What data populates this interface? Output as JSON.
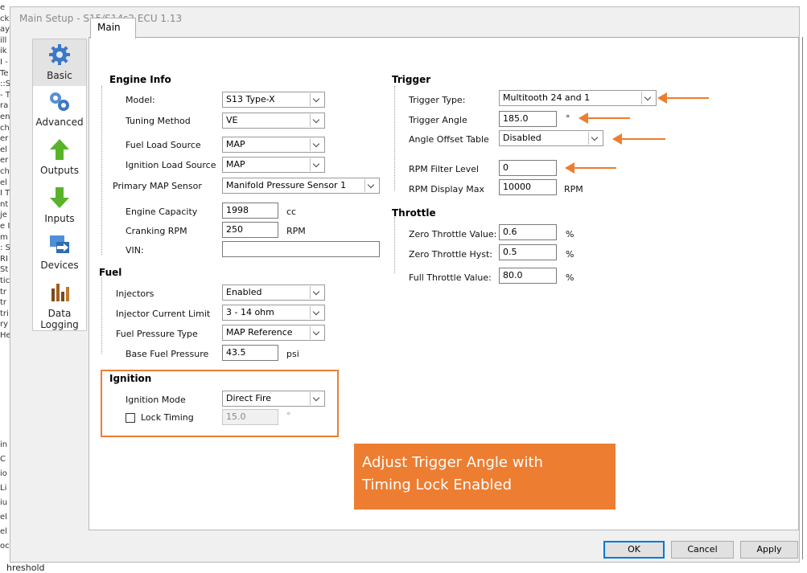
{
  "window": {
    "title": "Main Setup - S15/S14s2 ECU 1.13"
  },
  "tabs": [
    {
      "label": "Main"
    }
  ],
  "sidebar": {
    "items": [
      {
        "label": "Basic",
        "icon": "gear-icon"
      },
      {
        "label": "Advanced",
        "icon": "gears-icon"
      },
      {
        "label": "Outputs",
        "icon": "arrow-up-icon"
      },
      {
        "label": "Inputs",
        "icon": "arrow-down-icon"
      },
      {
        "label": "Devices",
        "icon": "devices-icon"
      },
      {
        "label": "Data Logging",
        "icon": "chart-icon"
      }
    ]
  },
  "engine_info": {
    "title": "Engine Info",
    "model": {
      "label": "Model:",
      "value": "S13 Type-X"
    },
    "tuning_method": {
      "label": "Tuning Method",
      "value": "VE"
    },
    "fuel_load_source": {
      "label": "Fuel Load Source",
      "value": "MAP"
    },
    "ignition_load_source": {
      "label": "Ignition Load Source",
      "value": "MAP"
    },
    "primary_map_sensor": {
      "label": "Primary MAP Sensor",
      "value": "Manifold Pressure Sensor 1"
    },
    "engine_capacity": {
      "label": "Engine Capacity",
      "value": "1998",
      "unit": "cc"
    },
    "cranking_rpm": {
      "label": "Cranking RPM",
      "value": "250",
      "unit": "RPM"
    },
    "vin": {
      "label": "VIN:",
      "value": ""
    }
  },
  "fuel": {
    "title": "Fuel",
    "injectors": {
      "label": "Injectors",
      "value": "Enabled"
    },
    "injector_current_limit": {
      "label": "Injector Current Limit",
      "value": "3 - 14 ohm"
    },
    "fuel_pressure_type": {
      "label": "Fuel Pressure Type",
      "value": "MAP Reference"
    },
    "base_fuel_pressure": {
      "label": "Base Fuel Pressure",
      "value": "43.5",
      "unit": "psi"
    }
  },
  "ignition": {
    "title": "Ignition",
    "ignition_mode": {
      "label": "Ignition Mode",
      "value": "Direct Fire"
    },
    "lock_timing": {
      "label": "Lock Timing",
      "checked": false,
      "value": "15.0",
      "unit": "°"
    }
  },
  "trigger": {
    "title": "Trigger",
    "trigger_type": {
      "label": "Trigger Type:",
      "value": "Multitooth 24 and 1"
    },
    "trigger_angle": {
      "label": "Trigger Angle",
      "value": "185.0",
      "unit": "°"
    },
    "angle_offset_table": {
      "label": "Angle Offset Table",
      "value": "Disabled"
    },
    "rpm_filter_level": {
      "label": "RPM Filter Level",
      "value": "0"
    },
    "rpm_display_max": {
      "label": "RPM Display Max",
      "value": "10000",
      "unit": "RPM"
    }
  },
  "throttle": {
    "title": "Throttle",
    "zero_throttle_value": {
      "label": "Zero Throttle Value:",
      "value": "0.6",
      "unit": "%"
    },
    "zero_throttle_hyst": {
      "label": "Zero Throttle Hyst:",
      "value": "0.5",
      "unit": "%"
    },
    "full_throttle_value": {
      "label": "Full Throttle Value:",
      "value": "80.0",
      "unit": "%"
    }
  },
  "callout": {
    "line1": "Adjust Trigger Angle with",
    "line2": "Timing Lock Enabled",
    "color": "#ed7d31"
  },
  "buttons": {
    "ok": "OK",
    "cancel": "Cancel",
    "apply": "Apply"
  },
  "background": {
    "left_fragments": [
      "e",
      "ck",
      "ay",
      "ill",
      "ik",
      "I -",
      "Te",
      "::S",
      "- T",
      "ra",
      "en",
      "ch",
      "er",
      "el",
      "er",
      "ch",
      "el",
      "I T",
      "nt",
      "je",
      "e I",
      "m",
      ": S",
      "RI",
      "St",
      "tic",
      "tr",
      "tr",
      "tri",
      "ry",
      "He"
    ],
    "left_fragments_lower": [
      "in",
      "C",
      "io",
      "Li",
      "iu",
      "el",
      "el",
      "oc"
    ],
    "bottom_text": "hreshold"
  }
}
